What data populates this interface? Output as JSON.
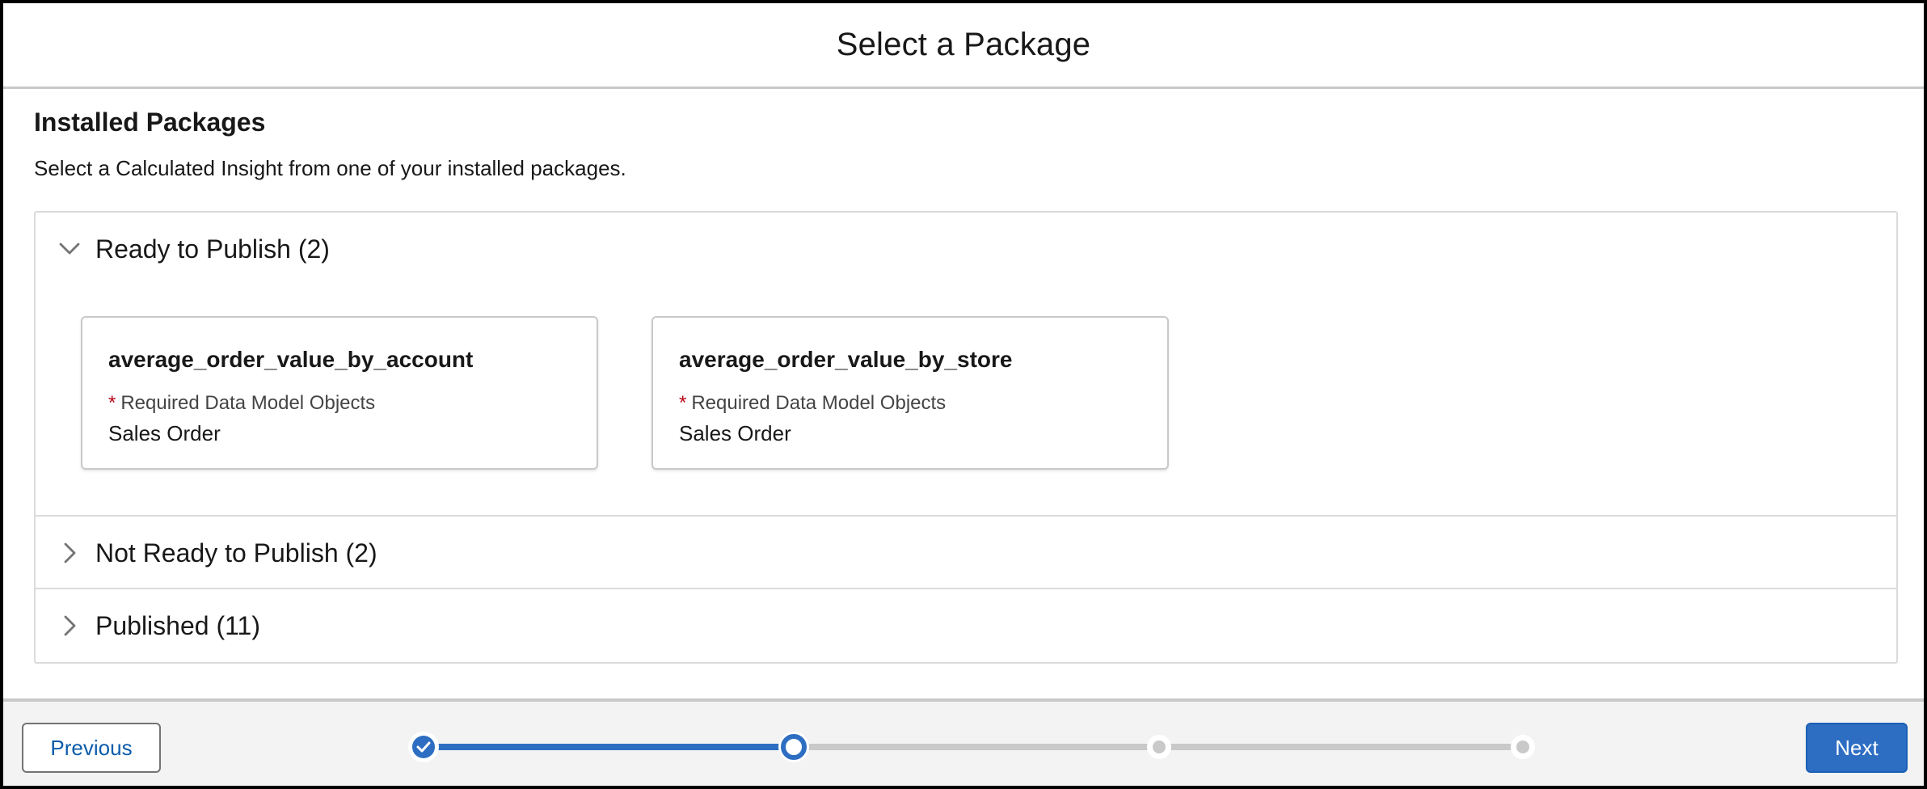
{
  "modal": {
    "title": "Select a Package"
  },
  "body": {
    "section_title": "Installed Packages",
    "section_desc": "Select a Calculated Insight from one of your installed packages."
  },
  "accordion": [
    {
      "label": "Ready to Publish (2)",
      "expanded": true
    },
    {
      "label": "Not Ready to Publish (2)",
      "expanded": false
    },
    {
      "label": "Published (11)",
      "expanded": false
    }
  ],
  "cards": [
    {
      "title": "average_order_value_by_account",
      "req_label": "Required Data Model Objects",
      "req_star": "*",
      "value": "Sales Order"
    },
    {
      "title": "average_order_value_by_store",
      "req_label": "Required Data Model Objects",
      "req_star": "*",
      "value": "Sales Order"
    }
  ],
  "footer": {
    "previous_label": "Previous",
    "next_label": "Next",
    "progress_steps": [
      {
        "state": "completed"
      },
      {
        "state": "current"
      },
      {
        "state": "upcoming"
      },
      {
        "state": "upcoming"
      }
    ]
  },
  "colors": {
    "brand": "#2e6ec2",
    "link": "#0b5cab",
    "required": "#ba0517",
    "track": "#c9c9c9"
  }
}
